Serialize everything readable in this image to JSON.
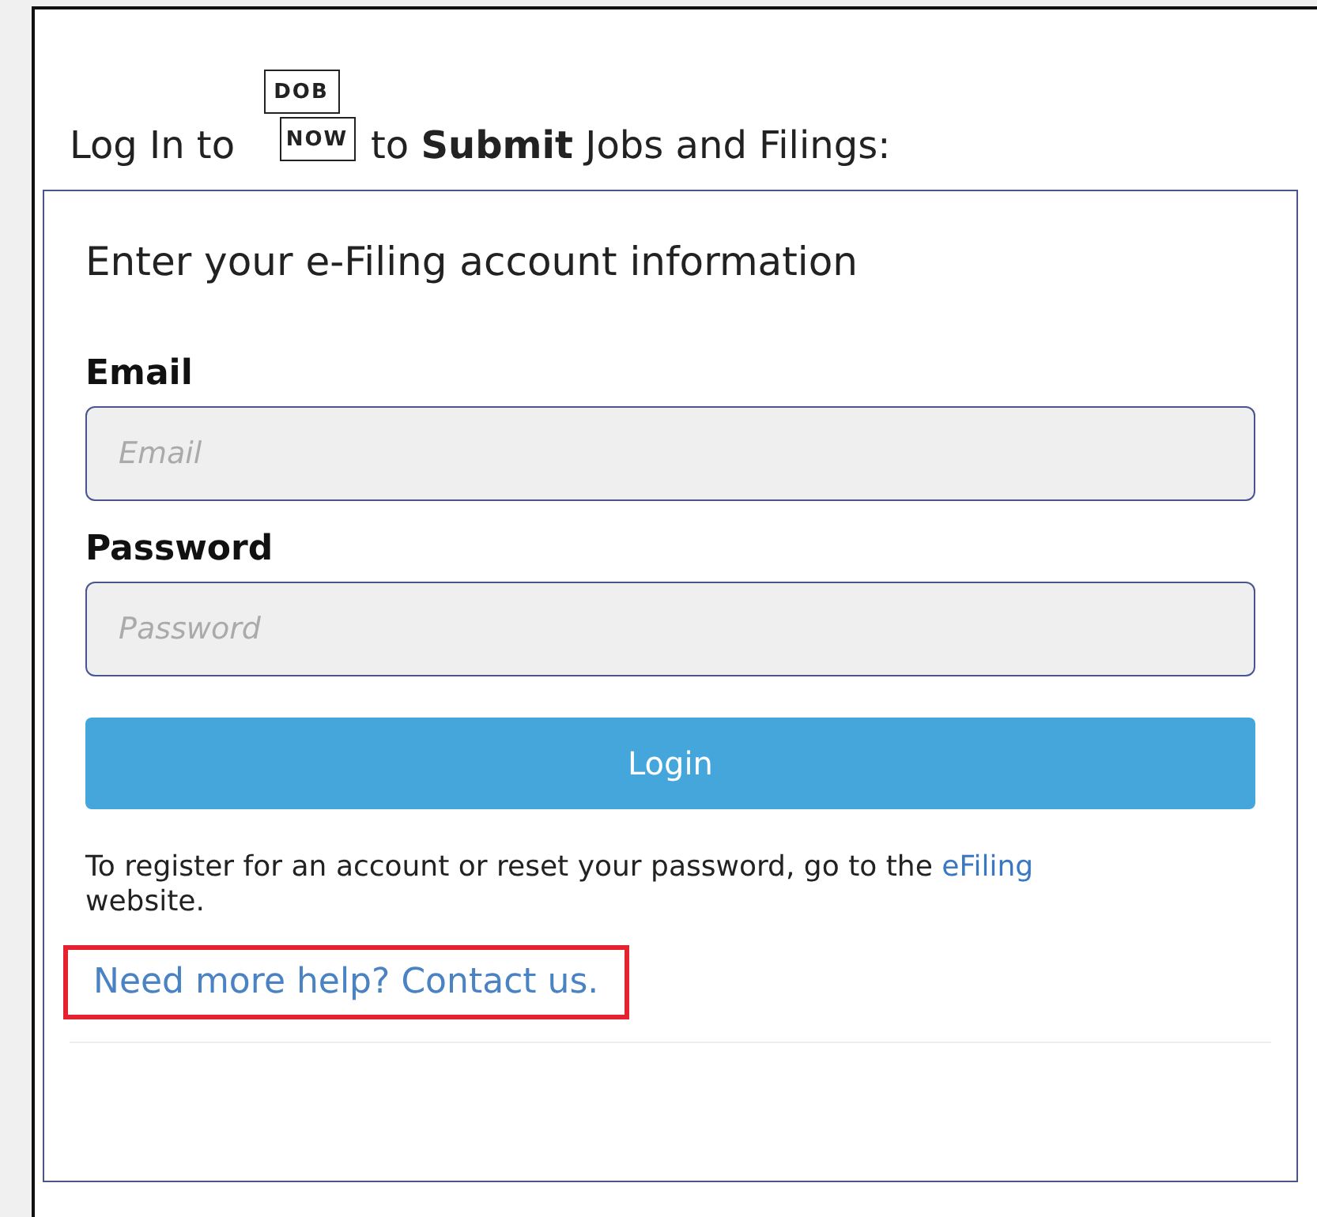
{
  "heading": {
    "before": "Log In to",
    "logo": {
      "top": "DOB",
      "bottom": "NOW"
    },
    "after": "to **Submit** Jobs and Filings:"
  },
  "form": {
    "title": "Enter your e-Filing account information",
    "fields": [
      {
        "label": "Email",
        "placeholder": "Email"
      },
      {
        "label": "Password",
        "placeholder": "Password"
      }
    ],
    "button": "Login",
    "note": {
      "text": "To register for an account or reset your password, go to the",
      "link": "eFiling",
      "tail": "website."
    },
    "help": {
      "text": "Need more help? Contact us.",
      "highlighted": true
    }
  }
}
